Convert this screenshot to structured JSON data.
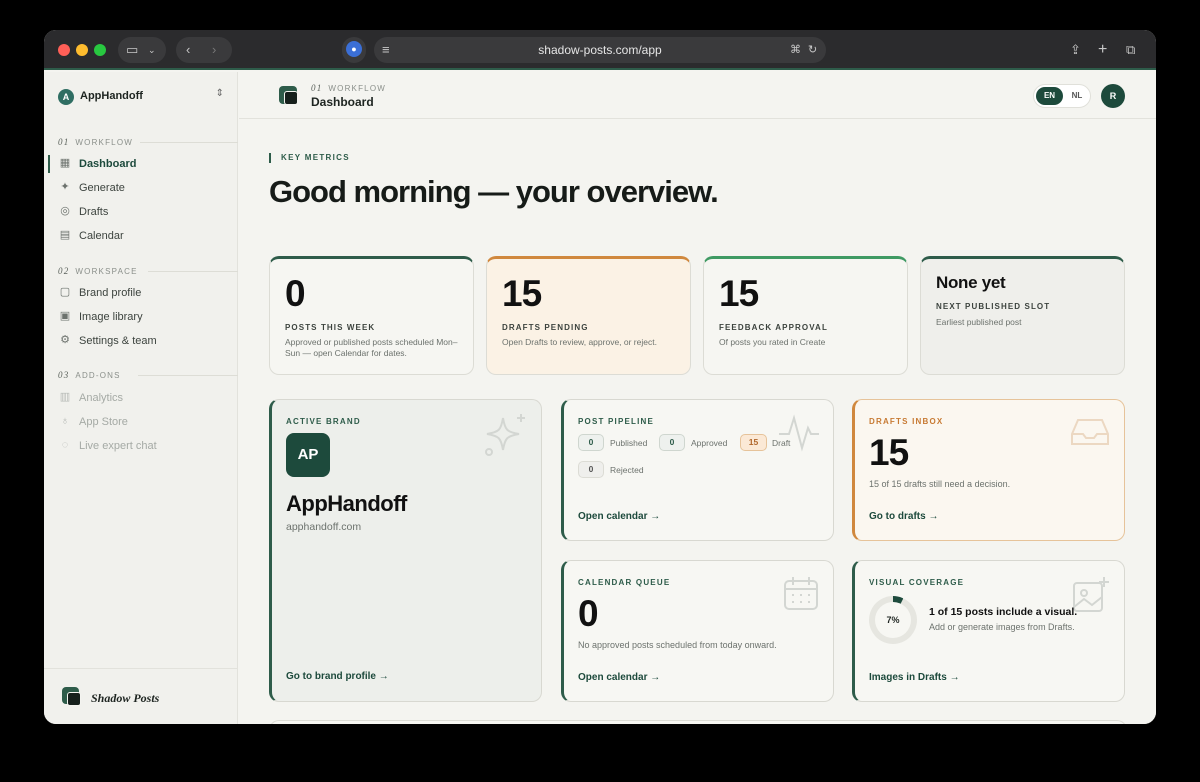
{
  "browser": {
    "url": "shadow-posts.com/app",
    "colors": {
      "close": "#ff5f57",
      "minimize": "#febc2e",
      "maximize": "#28c840"
    }
  },
  "sidebar": {
    "brand_selector": {
      "badge": "A",
      "name": "AppHandoff"
    },
    "sections": [
      {
        "num": "01",
        "label": "WORKFLOW"
      },
      {
        "num": "02",
        "label": "WORKSPACE"
      },
      {
        "num": "03",
        "label": "ADD-ONS"
      }
    ],
    "workflow_items": [
      {
        "label": "Dashboard",
        "icon": "grid-icon"
      },
      {
        "label": "Generate",
        "icon": "sparkle-icon"
      },
      {
        "label": "Drafts",
        "icon": "check-circle-icon"
      },
      {
        "label": "Calendar",
        "icon": "calendar-icon"
      }
    ],
    "workspace_items": [
      {
        "label": "Brand profile",
        "icon": "document-icon"
      },
      {
        "label": "Image library",
        "icon": "image-icon"
      },
      {
        "label": "Settings & team",
        "icon": "gear-icon"
      }
    ],
    "addon_items": [
      {
        "label": "Analytics",
        "icon": "chart-icon"
      },
      {
        "label": "App Store",
        "icon": "bulb-icon"
      },
      {
        "label": "Live expert chat",
        "icon": "chat-icon"
      }
    ],
    "footer": {
      "app_name": "Shadow Posts"
    }
  },
  "topbar": {
    "section_num": "01",
    "section_label": "WORKFLOW",
    "title": "Dashboard",
    "lang_active": "EN",
    "lang_other": "NL",
    "avatar": "R"
  },
  "hero": {
    "kicker": "KEY METRICS",
    "greeting": "Good morning — your overview."
  },
  "metrics": [
    {
      "value": "0",
      "label": "POSTS THIS WEEK",
      "sub": "Approved or published posts scheduled Mon–Sun — open Calendar for dates."
    },
    {
      "value": "15",
      "label": "DRAFTS PENDING",
      "sub": "Open Drafts to review, approve, or reject."
    },
    {
      "value": "15",
      "label": "FEEDBACK APPROVAL",
      "sub": "Of posts you rated in Create"
    },
    {
      "value": "None yet",
      "label": "NEXT PUBLISHED SLOT",
      "sub": "Earliest published post"
    }
  ],
  "active_brand": {
    "kicker": "ACTIVE BRAND",
    "initials": "AP",
    "name": "AppHandoff",
    "url": "apphandoff.com",
    "link": "Go to brand profile →"
  },
  "pipeline": {
    "kicker": "POST PIPELINE",
    "stats": [
      {
        "count": "0",
        "label": "Published"
      },
      {
        "count": "0",
        "label": "Approved"
      },
      {
        "count": "15",
        "label": "Draft"
      },
      {
        "count": "0",
        "label": "Rejected"
      }
    ],
    "link": "Open calendar →"
  },
  "inbox": {
    "kicker": "DRAFTS INBOX",
    "value": "15",
    "sub": "15 of 15 drafts still need a decision.",
    "link": "Go to drafts →"
  },
  "queue": {
    "kicker": "CALENDAR QUEUE",
    "value": "0",
    "sub": "No approved posts scheduled from today onward.",
    "link": "Open calendar →"
  },
  "visual": {
    "kicker": "VISUAL COVERAGE",
    "percent_label": "7%",
    "percent": 7,
    "title": "1 of 15 posts include a visual.",
    "sub": "Add or generate images from Drafts.",
    "link": "Images in Drafts →"
  }
}
